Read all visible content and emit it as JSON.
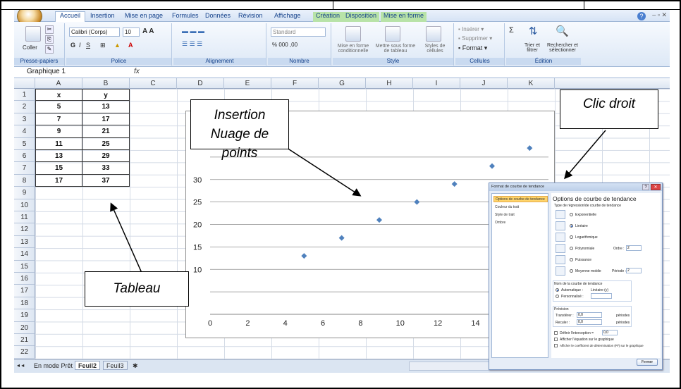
{
  "ribbon_tabs": [
    "Accueil",
    "Insertion",
    "Mise en page",
    "Formules",
    "Données",
    "Révision",
    "Affichage",
    "Création",
    "Disposition",
    "Mise en forme"
  ],
  "window_controls": "–  ▫  ✕",
  "ribbon": {
    "clipboard": {
      "paste_label": "Coller",
      "group_label": "Presse-papiers"
    },
    "font": {
      "font_name": "Calibri (Corps)",
      "font_size": "10",
      "group_label": "Police"
    },
    "alignment": {
      "group_label": "Alignement"
    },
    "number": {
      "format": "Standard",
      "group_label": "Nombre"
    },
    "style": {
      "cond_format": "Mise en forme conditionnelle",
      "as_table": "Mettre sous forme de tableau",
      "cell_styles": "Styles de cellules",
      "group_label": "Style"
    },
    "cells": {
      "insert": "Insérer",
      "delete": "Supprimer",
      "format": "Format",
      "group_label": "Cellules"
    },
    "editing": {
      "sort": "Trier et filtrer",
      "find": "Rechercher et sélectionner",
      "group_label": "Édition"
    }
  },
  "formula_bar": {
    "name_box": "Graphique 1",
    "fx": "fx"
  },
  "columns": [
    "A",
    "B",
    "C",
    "D",
    "E",
    "F",
    "G",
    "H",
    "I",
    "J",
    "K"
  ],
  "rows": [
    "1",
    "2",
    "3",
    "4",
    "5",
    "6",
    "7",
    "8",
    "9",
    "10",
    "11",
    "12",
    "13",
    "14",
    "15",
    "16",
    "17",
    "18",
    "19",
    "20",
    "21",
    "22"
  ],
  "table": {
    "headers": [
      "x",
      "y"
    ],
    "rows": [
      [
        "5",
        "13"
      ],
      [
        "7",
        "17"
      ],
      [
        "9",
        "21"
      ],
      [
        "11",
        "25"
      ],
      [
        "13",
        "29"
      ],
      [
        "15",
        "33"
      ],
      [
        "17",
        "37"
      ]
    ]
  },
  "sheet_tabs": [
    "Feuil2",
    "Feuil3"
  ],
  "status_text": "En mode Prêt",
  "chart_data": {
    "type": "scatter",
    "x": [
      5,
      7,
      9,
      11,
      13,
      15,
      17
    ],
    "y": [
      13,
      17,
      21,
      25,
      29,
      33,
      37
    ],
    "x_ticks": [
      "0",
      "2",
      "4",
      "6",
      "8",
      "10",
      "12",
      "14"
    ],
    "y_ticks": [
      "10",
      "15",
      "20",
      "25",
      "30"
    ],
    "xlim": [
      0,
      18
    ],
    "ylim": [
      0,
      40
    ],
    "grid": true,
    "marker_color": "#4f81bd"
  },
  "dialog": {
    "title": "Format de courbe de tendance",
    "nav_items": [
      "Options de courbe de tendance",
      "Couleur du trait",
      "Style de trait",
      "Ombre"
    ],
    "heading": "Options de courbe de tendance",
    "type_label": "Type de régression/de courbe de tendance",
    "options": [
      "Exponentielle",
      "Linéaire",
      "Logarithmique",
      "Polynomiale",
      "Puissance",
      "Moyenne mobile"
    ],
    "order_label": "Ordre :",
    "order_value": "2",
    "period_label": "Période :",
    "period_value": "2",
    "name_section": "Nom de la courbe de tendance",
    "auto_label": "Automatique :",
    "auto_value": "Linéaire (y)",
    "custom_label": "Personnalisé :",
    "forecast_section": "Prévision",
    "forward_label": "Transférer :",
    "forward_value": "0,0",
    "backward_label": "Reculer :",
    "backward_value": "0,0",
    "periods": "périodes",
    "intercept_label": "Définir l'interception =",
    "intercept_value": "0,0",
    "show_equation": "Afficher l'équation sur le graphique",
    "show_r2": "Afficher le coefficient de détermination (R²) sur le graphique",
    "close_button": "Fermer"
  },
  "annotations": {
    "insertion_line1": "Insertion",
    "insertion_line2": "Nuage de points",
    "right_click": "Clic droit",
    "table_label": "Tableau"
  }
}
